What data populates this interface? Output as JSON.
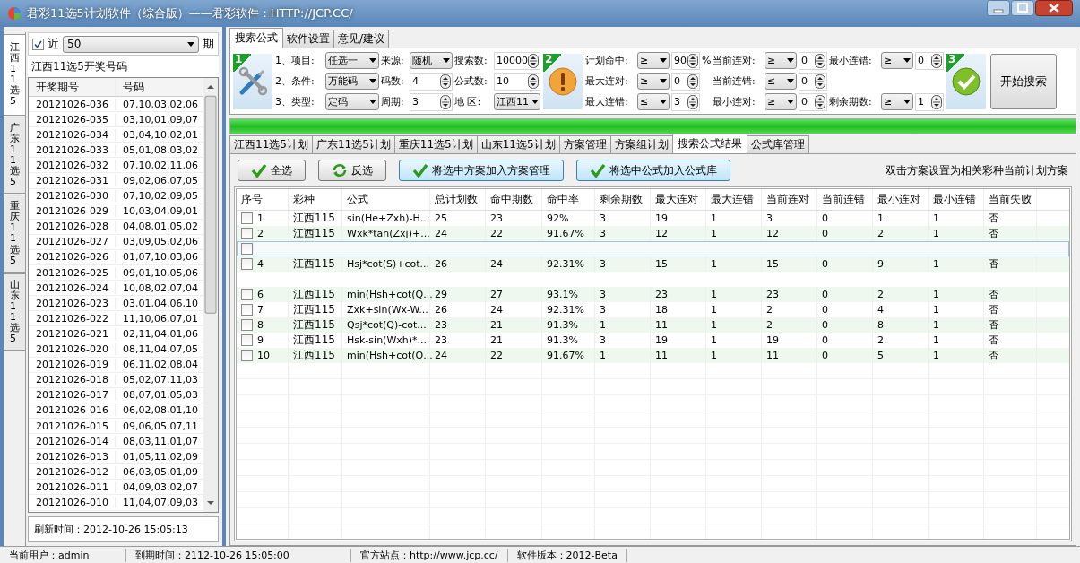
{
  "window": {
    "title": "君彩11选5计划软件（综合版）——君彩软件：HTTP://JCP.CC/"
  },
  "left": {
    "recent": {
      "checked": true,
      "label": "近",
      "value": "50",
      "unit": "期"
    },
    "side_tabs": [
      {
        "label": "江西11选5",
        "selected": true
      },
      {
        "label": "广东11选5",
        "selected": false
      },
      {
        "label": "重庆11选5",
        "selected": false
      },
      {
        "label": "山东11选5",
        "selected": false
      }
    ],
    "list_title": "江西11选5开奖号码",
    "columns": [
      "开奖期号",
      "号码"
    ],
    "rows": [
      [
        "20121026-036",
        "07,10,03,02,06"
      ],
      [
        "20121026-035",
        "03,10,01,09,07"
      ],
      [
        "20121026-034",
        "03,04,10,02,01"
      ],
      [
        "20121026-033",
        "05,01,08,03,02"
      ],
      [
        "20121026-032",
        "07,10,02,11,06"
      ],
      [
        "20121026-031",
        "09,02,06,07,05"
      ],
      [
        "20121026-030",
        "07,10,02,09,05"
      ],
      [
        "20121026-029",
        "10,03,04,09,01"
      ],
      [
        "20121026-028",
        "04,08,01,05,02"
      ],
      [
        "20121026-027",
        "03,09,05,02,06"
      ],
      [
        "20121026-026",
        "01,07,10,03,06"
      ],
      [
        "20121026-025",
        "09,01,10,05,06"
      ],
      [
        "20121026-024",
        "10,08,02,07,04"
      ],
      [
        "20121026-023",
        "03,01,04,06,10"
      ],
      [
        "20121026-022",
        "11,10,06,07,01"
      ],
      [
        "20121026-021",
        "02,11,04,01,06"
      ],
      [
        "20121026-020",
        "08,11,04,07,05"
      ],
      [
        "20121026-019",
        "06,11,02,08,04"
      ],
      [
        "20121026-018",
        "05,02,07,11,03"
      ],
      [
        "20121026-017",
        "08,07,01,05,03"
      ],
      [
        "20121026-016",
        "06,02,08,01,10"
      ],
      [
        "20121026-015",
        "09,06,05,07,11"
      ],
      [
        "20121026-014",
        "08,03,11,01,07"
      ],
      [
        "20121026-013",
        "01,05,11,02,09"
      ],
      [
        "20121026-012",
        "06,03,05,01,09"
      ],
      [
        "20121026-011",
        "04,09,03,02,07"
      ],
      [
        "20121026-010",
        "11,04,07,09,03"
      ]
    ],
    "refresh": "刷新时间：2012-10-26 15:05:13"
  },
  "top_tabs": [
    {
      "label": "搜索公式",
      "selected": true
    },
    {
      "label": "软件设置",
      "selected": false
    },
    {
      "label": "意见/建议",
      "selected": false
    }
  ],
  "steps": [
    {
      "badge": "1",
      "rows": [
        [
          {
            "kind": "label",
            "text": "1、项目:"
          },
          {
            "kind": "select",
            "value": "任选一"
          },
          {
            "kind": "label",
            "text": "来源:"
          },
          {
            "kind": "select",
            "value": "随机"
          },
          {
            "kind": "label",
            "text": "搜索数:"
          },
          {
            "kind": "spin",
            "value": "10000"
          }
        ],
        [
          {
            "kind": "label",
            "text": "2、条件:"
          },
          {
            "kind": "select",
            "value": "万能码"
          },
          {
            "kind": "label",
            "text": "码数:"
          },
          {
            "kind": "spin",
            "value": "4"
          },
          {
            "kind": "label",
            "text": "公式数:"
          },
          {
            "kind": "spin",
            "value": "10"
          }
        ],
        [
          {
            "kind": "label",
            "text": "3、类型:"
          },
          {
            "kind": "select",
            "value": "定码"
          },
          {
            "kind": "label",
            "text": "周期:"
          },
          {
            "kind": "spin",
            "value": "3"
          },
          {
            "kind": "label",
            "text": "地 区:"
          },
          {
            "kind": "select",
            "value": "江西11"
          }
        ]
      ]
    },
    {
      "badge": "2",
      "rows": [
        [
          {
            "kind": "label",
            "text": "计划命中:"
          },
          {
            "kind": "select",
            "value": "≥"
          },
          {
            "kind": "spin",
            "value": "90"
          },
          {
            "kind": "label",
            "text": "%"
          },
          {
            "kind": "label",
            "text": "当前连对:"
          },
          {
            "kind": "select",
            "value": "≥"
          },
          {
            "kind": "spin",
            "value": "0"
          },
          {
            "kind": "label",
            "text": "最小连错:"
          },
          {
            "kind": "select",
            "value": "≥"
          },
          {
            "kind": "spin",
            "value": "0"
          }
        ],
        [
          {
            "kind": "label",
            "text": "最大连对:"
          },
          {
            "kind": "select",
            "value": "≥"
          },
          {
            "kind": "spin",
            "value": "0"
          },
          {
            "kind": "gap"
          },
          {
            "kind": "label",
            "text": "当前连错:"
          },
          {
            "kind": "select",
            "value": "≤"
          },
          {
            "kind": "spin",
            "value": "0"
          }
        ],
        [
          {
            "kind": "label",
            "text": "最大连错:"
          },
          {
            "kind": "select",
            "value": "≤"
          },
          {
            "kind": "spin",
            "value": "3"
          },
          {
            "kind": "gap"
          },
          {
            "kind": "label",
            "text": "最小连对:"
          },
          {
            "kind": "select",
            "value": "≥"
          },
          {
            "kind": "spin",
            "value": "0"
          },
          {
            "kind": "label",
            "text": "剩余期数:"
          },
          {
            "kind": "select",
            "value": "≥"
          },
          {
            "kind": "spin",
            "value": "1"
          }
        ]
      ]
    }
  ],
  "final_step": {
    "badge": "3",
    "button": "开始搜索"
  },
  "progress": {
    "level": 1
  },
  "plan_tabs": [
    {
      "label": "江西11选5计划",
      "selected": false
    },
    {
      "label": "广东11选5计划",
      "selected": false
    },
    {
      "label": "重庆11选5计划",
      "selected": false
    },
    {
      "label": "山东11选5计划",
      "selected": false
    },
    {
      "label": "方案管理",
      "selected": false
    },
    {
      "label": "方案组计划",
      "selected": false
    },
    {
      "label": "搜索公式结果",
      "selected": true
    },
    {
      "label": "公式库管理",
      "selected": false
    }
  ],
  "toolbar": {
    "buttons": [
      {
        "label": "全选"
      },
      {
        "label": "反选"
      },
      {
        "label": "将选中方案加入方案管理"
      },
      {
        "label": "将选中公式加入公式库"
      }
    ],
    "hint": "双击方案设置为相关彩种当前计划方案"
  },
  "table": {
    "columns": [
      "序号",
      "彩种",
      "公式",
      "总计划数",
      "命中期数",
      "命中率",
      "剩余期数",
      "最大连对",
      "最大连错",
      "当前连对",
      "当前连错",
      "最小连对",
      "最小连错",
      "当前失败"
    ],
    "rows": [
      {
        "kind": "data",
        "checked": false,
        "selected": false,
        "cells": [
          "1",
          "江西115",
          "sin(He+Zxh)-H...",
          "25",
          "23",
          "92%",
          "3",
          "19",
          "1",
          "3",
          "0",
          "1",
          "1",
          "否"
        ]
      },
      {
        "kind": "data",
        "checked": false,
        "selected": false,
        "cells": [
          "2",
          "江西115",
          "Wxk*tan(Zxj)+...",
          "24",
          "22",
          "91.67%",
          "3",
          "12",
          "1",
          "12",
          "0",
          "2",
          "1",
          "否"
        ]
      },
      {
        "kind": "checkbox",
        "checked": false,
        "selected": true
      },
      {
        "kind": "data",
        "checked": false,
        "selected": false,
        "cells": [
          "4",
          "江西115",
          "Hsj*cot(S)+cot...",
          "26",
          "24",
          "92.31%",
          "3",
          "15",
          "1",
          "15",
          "0",
          "9",
          "1",
          "否"
        ]
      },
      {
        "kind": "blank"
      },
      {
        "kind": "data",
        "checked": false,
        "selected": false,
        "cells": [
          "6",
          "江西115",
          "min(Hsh+cot(Q...",
          "29",
          "27",
          "93.1%",
          "3",
          "23",
          "1",
          "23",
          "0",
          "2",
          "1",
          "否"
        ]
      },
      {
        "kind": "data",
        "checked": false,
        "selected": false,
        "cells": [
          "7",
          "江西115",
          "Zxk+sin(Wx-W...",
          "26",
          "24",
          "92.31%",
          "3",
          "18",
          "1",
          "2",
          "0",
          "4",
          "1",
          "否"
        ]
      },
      {
        "kind": "data",
        "checked": false,
        "selected": false,
        "cells": [
          "8",
          "江西115",
          "Qsj*cot(Q)-cot...",
          "23",
          "21",
          "91.3%",
          "1",
          "11",
          "1",
          "2",
          "0",
          "8",
          "1",
          "否"
        ]
      },
      {
        "kind": "data",
        "checked": false,
        "selected": false,
        "cells": [
          "9",
          "江西115",
          "Hsk-sin(Wxh)*...",
          "23",
          "21",
          "91.3%",
          "3",
          "19",
          "1",
          "19",
          "0",
          "2",
          "1",
          "否"
        ]
      },
      {
        "kind": "data",
        "checked": false,
        "selected": false,
        "cells": [
          "10",
          "江西115",
          "min(Hsh+cot(Q...",
          "24",
          "22",
          "91.67%",
          "1",
          "11",
          "1",
          "11",
          "0",
          "5",
          "1",
          "否"
        ]
      }
    ]
  },
  "status_bar": [
    "当前用户：admin",
    "到期时间：2112-10-26 15:05:00",
    "官方站点：http://www.jcp.cc/",
    "软件版本：2012-Beta"
  ]
}
